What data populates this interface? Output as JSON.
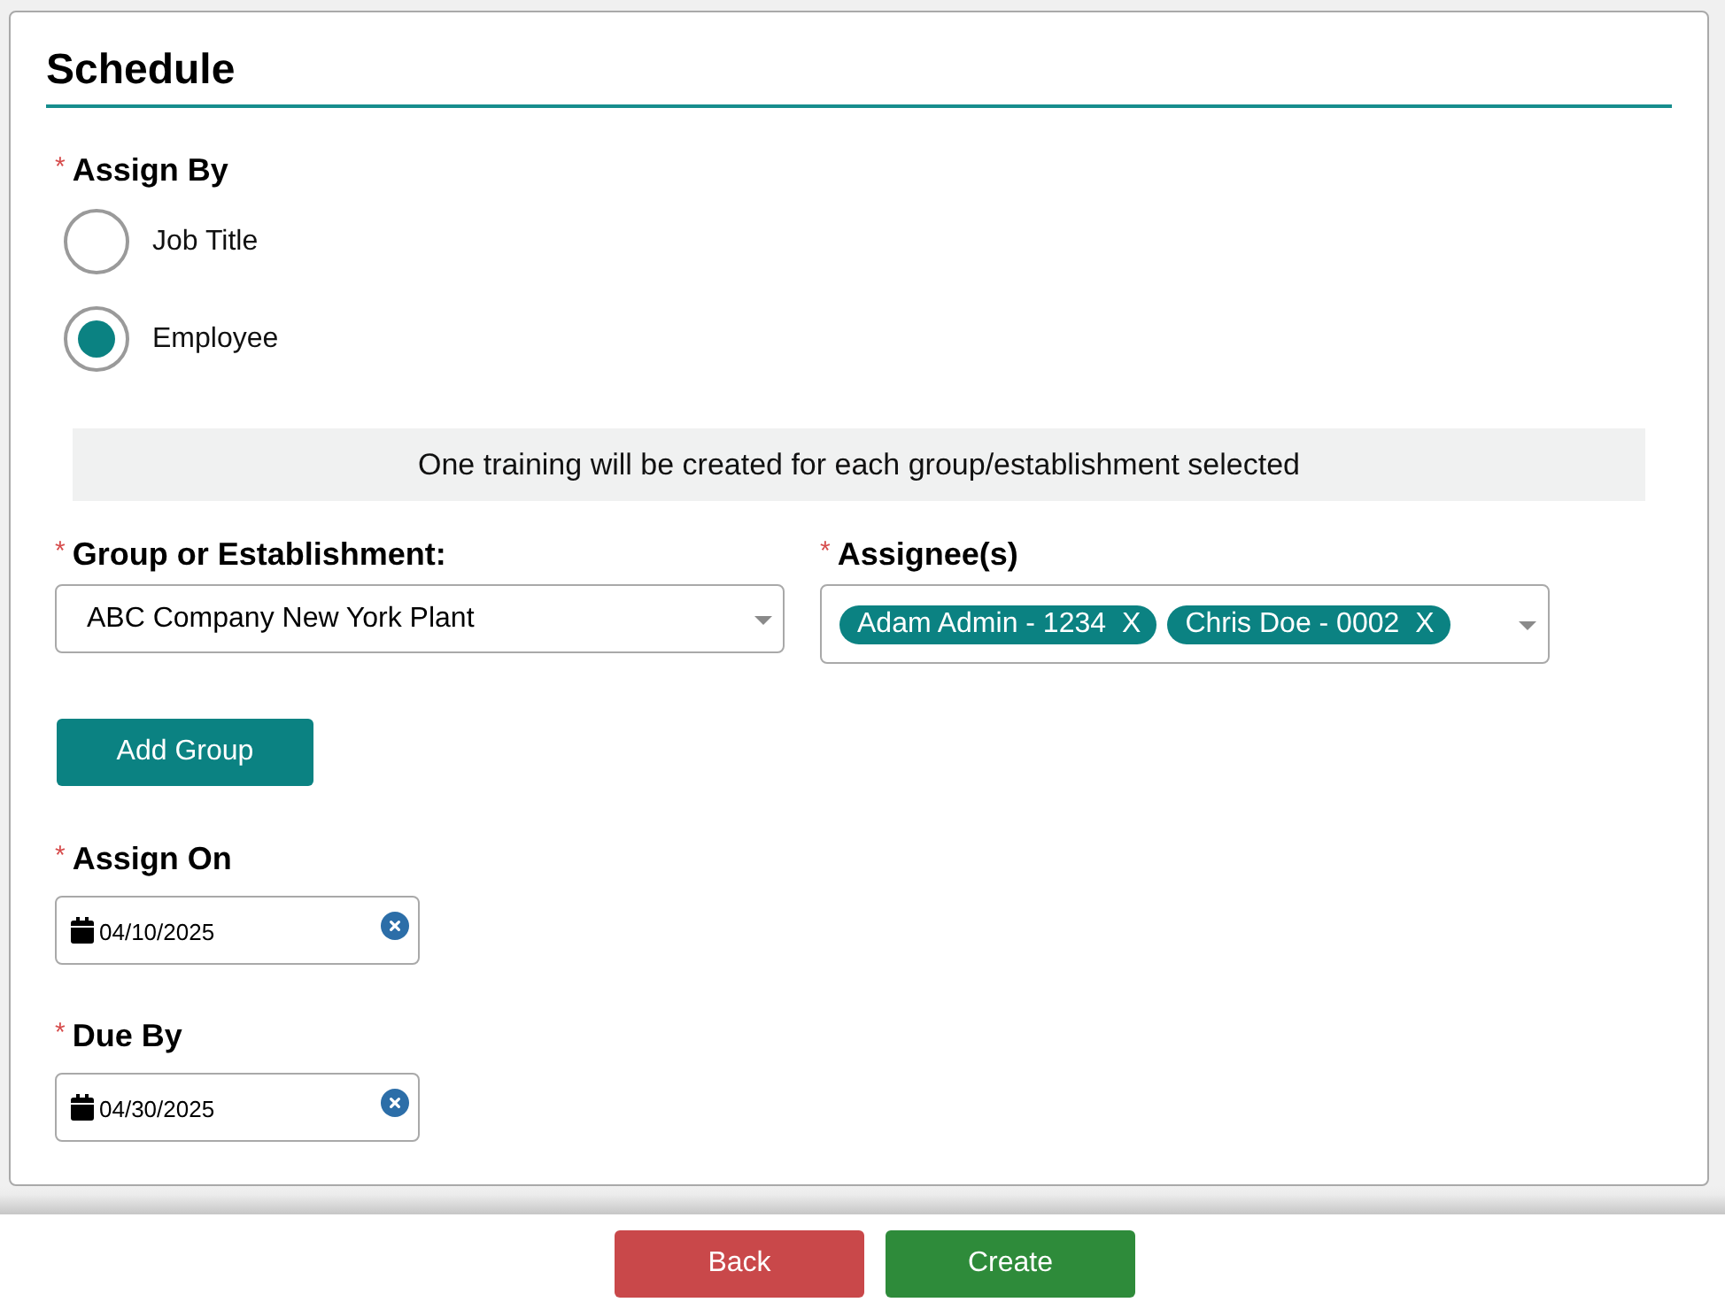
{
  "section": {
    "title": "Schedule"
  },
  "assign_by": {
    "required_mark": "*",
    "label": "Assign By",
    "options": [
      {
        "label": "Job Title",
        "selected": false
      },
      {
        "label": "Employee",
        "selected": true
      }
    ]
  },
  "notice": "One training will be created for each group/establishment selected",
  "group": {
    "required_mark": "*",
    "label": "Group or Establishment:",
    "value": "ABC Company New York Plant"
  },
  "assignees": {
    "required_mark": "*",
    "label": "Assignee(s)",
    "chips": [
      {
        "label": "Adam Admin - 1234",
        "remove": "X"
      },
      {
        "label": "Chris Doe - 0002",
        "remove": "X"
      }
    ]
  },
  "add_group_button": "Add Group",
  "dates": [
    {
      "required_mark": "*",
      "label": "Assign On",
      "value": "04/10/2025"
    },
    {
      "required_mark": "*",
      "label": "Due By",
      "value": "04/30/2025"
    }
  ],
  "buttons": [
    {
      "label": "Back",
      "kind": "back"
    },
    {
      "label": "Create",
      "kind": "create"
    }
  ]
}
